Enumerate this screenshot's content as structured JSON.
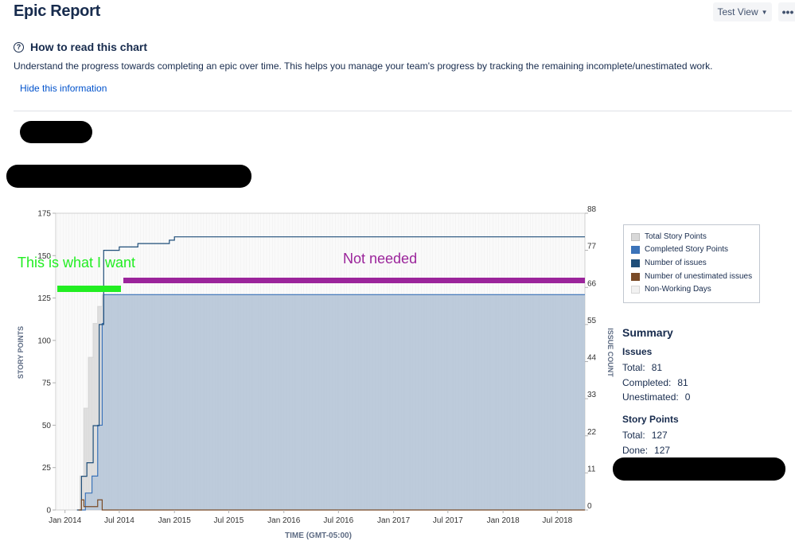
{
  "header": {
    "title": "Epic Report",
    "view_label": "Test View",
    "more_label": "•••"
  },
  "help": {
    "heading": "How to read this chart",
    "icon_glyph": "?",
    "description": "Understand the progress towards completing an epic over time. This helps you manage your team's progress by tracking the remaining incomplete/unestimated work.",
    "hide_label": "Hide this information"
  },
  "annotations": {
    "want": "This is what I want",
    "not_needed": "Not needed",
    "want_color": "#22ee22",
    "not_needed_color": "#9b249b"
  },
  "legend": [
    {
      "label": "Total Story Points",
      "color": "#d8d8d8"
    },
    {
      "label": "Completed Story Points",
      "color": "#3b73b9"
    },
    {
      "label": "Number of issues",
      "color": "#1f4e79"
    },
    {
      "label": "Number of unestimated issues",
      "color": "#7a4b27"
    },
    {
      "label": "Non-Working Days",
      "color": "#f2f2f2"
    }
  ],
  "summary": {
    "title": "Summary",
    "issues": {
      "heading": "Issues",
      "total_label": "Total:",
      "total": "81",
      "completed_label": "Completed:",
      "completed": "81",
      "unestimated_label": "Unestimated:",
      "unestimated": "0"
    },
    "story_points": {
      "heading": "Story Points",
      "total_label": "Total:",
      "total": "127",
      "done_label": "Done:",
      "done": "127"
    }
  },
  "chart_data": {
    "type": "area",
    "xlabel": "TIME (GMT-05:00)",
    "ylabel_left": "STORY POINTS",
    "ylabel_right": "ISSUE COUNT",
    "x_ticks": [
      "Jan 2014",
      "Jul 2014",
      "Jan 2015",
      "Jul 2015",
      "Jan 2016",
      "Jul 2016",
      "Jan 2017",
      "Jul 2017",
      "Jan 2018",
      "Jul 2018"
    ],
    "x_range": [
      "2013-12",
      "2018-10"
    ],
    "y_left_ticks": [
      0,
      25,
      50,
      75,
      100,
      125,
      150,
      175
    ],
    "y_left_range": [
      0,
      175
    ],
    "y_right_ticks": [
      0,
      11,
      22,
      33,
      44,
      55,
      66,
      77,
      88
    ],
    "y_right_range": [
      0,
      88
    ],
    "series": [
      {
        "name": "Total Story Points",
        "axis": "left",
        "color": "#d8d8d8",
        "points": [
          [
            "2014-02-10",
            0
          ],
          [
            "2014-02-20",
            20
          ],
          [
            "2014-03-05",
            60
          ],
          [
            "2014-03-20",
            90
          ],
          [
            "2014-04-05",
            110
          ],
          [
            "2014-04-20",
            120
          ],
          [
            "2014-05-05",
            127
          ],
          [
            "2018-10-01",
            127
          ]
        ]
      },
      {
        "name": "Completed Story Points",
        "axis": "left",
        "color": "#3b73b9",
        "points": [
          [
            "2014-02-20",
            0
          ],
          [
            "2014-03-10",
            10
          ],
          [
            "2014-04-01",
            20
          ],
          [
            "2014-04-20",
            50
          ],
          [
            "2014-05-05",
            110
          ],
          [
            "2014-05-10",
            127
          ],
          [
            "2018-10-01",
            127
          ]
        ]
      },
      {
        "name": "Number of issues",
        "axis": "right",
        "color": "#1f4e79",
        "points": [
          [
            "2014-02-10",
            0
          ],
          [
            "2014-02-25",
            10
          ],
          [
            "2014-03-15",
            14
          ],
          [
            "2014-04-05",
            25
          ],
          [
            "2014-04-25",
            55
          ],
          [
            "2014-05-10",
            77
          ],
          [
            "2014-06-15",
            77
          ],
          [
            "2014-07-01",
            78
          ],
          [
            "2014-09-01",
            79
          ],
          [
            "2014-12-15",
            80
          ],
          [
            "2015-01-01",
            81
          ],
          [
            "2018-10-01",
            81
          ]
        ]
      },
      {
        "name": "Number of unestimated issues",
        "axis": "right",
        "color": "#7a4b27",
        "points": [
          [
            "2014-02-15",
            0
          ],
          [
            "2014-02-25",
            3
          ],
          [
            "2014-03-05",
            1
          ],
          [
            "2014-04-20",
            3
          ],
          [
            "2014-05-05",
            0
          ],
          [
            "2018-10-01",
            0
          ]
        ]
      }
    ],
    "grid": false,
    "legend_position": "right"
  }
}
